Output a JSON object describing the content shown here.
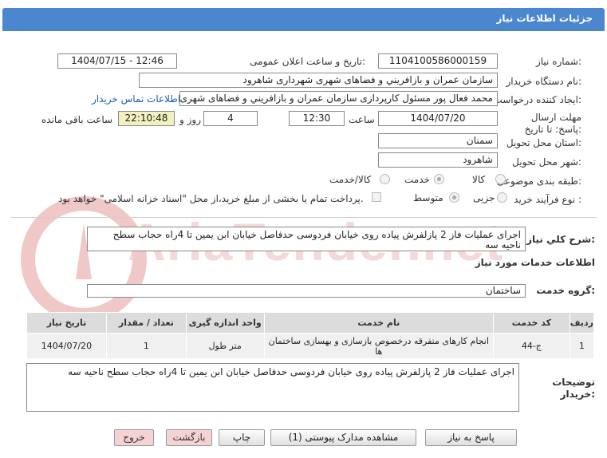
{
  "header": {
    "title": "جزئیات اطلاعات نیاز"
  },
  "fields": {
    "need_number_label": "شماره نیاز:",
    "need_number": "1104100586000159",
    "announce_label": "تاریخ و ساعت اعلان عمومی:",
    "announce_value": "1404/07/15 - 12:46",
    "buyer_label": "نام دستگاه خریدار:",
    "buyer_value": "سازمان عمران و بازافريني و فضاهای شهری شهرداری شاهرود",
    "creator_label": "ایجاد کننده درخواست:",
    "creator_value": "محمد فعال پور مسئول کارپردازی سازمان عمران و بازافريني و فضاهای شهری شاهرود",
    "contact_link": "اطلاعات تماس خریدار",
    "deadline_label": "مهلت ارسال پاسخ: تا تاریخ:",
    "deadline_date": "1404/07/20",
    "time_label": "ساعت",
    "deadline_time": "12:30",
    "days_value": "4",
    "days_label": "روز و",
    "remaining_time": "22:10:48",
    "remaining_label": "ساعت باقی مانده",
    "province_label": "استان محل تحویل:",
    "province_value": "سمنان",
    "city_label": "شهر محل تحویل:",
    "city_value": "شاهرود",
    "category_label": "طبقه بندی موضوعی:",
    "category_options": [
      "کالا",
      "خدمت",
      "کالا/خدمت"
    ],
    "category_selected": "خدمت",
    "process_label": "نوع فرآیند خرید :",
    "process_options": [
      "جزیی",
      "متوسط"
    ],
    "process_selected": "متوسط",
    "payment_note": "پرداخت تمام یا بخشی از مبلغ خرید،از محل \"اسناد خزانه اسلامی\" خواهد بود."
  },
  "summary": {
    "label": "شرح کلي نياز:",
    "text": "اجرای عملیات فاز 2 پازلفرش پیاده روی خیابان فردوسی حدفاصل خیابان ابن یمین تا 4راه حجاب سطح ناحیه سه"
  },
  "services": {
    "section_title": "اطلاعات خدمات مورد نیاز",
    "group_label": "گروه خدمت:",
    "group_value": "ساختمان",
    "table": {
      "headers": [
        "ردیف",
        "کد خدمت",
        "نام خدمت",
        "واحد اندازه گیری",
        "تعداد / مقدار",
        "تاریخ نیاز"
      ],
      "rows": [
        [
          "1",
          "ج-44",
          "انجام کارهای متفرقه درخصوص بازسازی و بهسازی ساختمان ها",
          "متر طول",
          "1",
          "1404/07/20"
        ]
      ]
    }
  },
  "buyer_notes": {
    "label": "توضیحات خریدار:",
    "text": "اجرای عملیات فاز 2 پازلفرش پیاده روی خیابان فردوسی حدفاصل خیابان ابن یمین تا 4راه حجاب سطح ناحیه سه"
  },
  "buttons": {
    "reply": "پاسخ به نیاز",
    "attachments": "مشاهده مدارک پیوستی (1)",
    "print": "چاپ",
    "back": "بازگشت",
    "exit": "خروج"
  },
  "watermark": {
    "text": "AriaTender.net",
    "color": "#e9a9a9"
  }
}
